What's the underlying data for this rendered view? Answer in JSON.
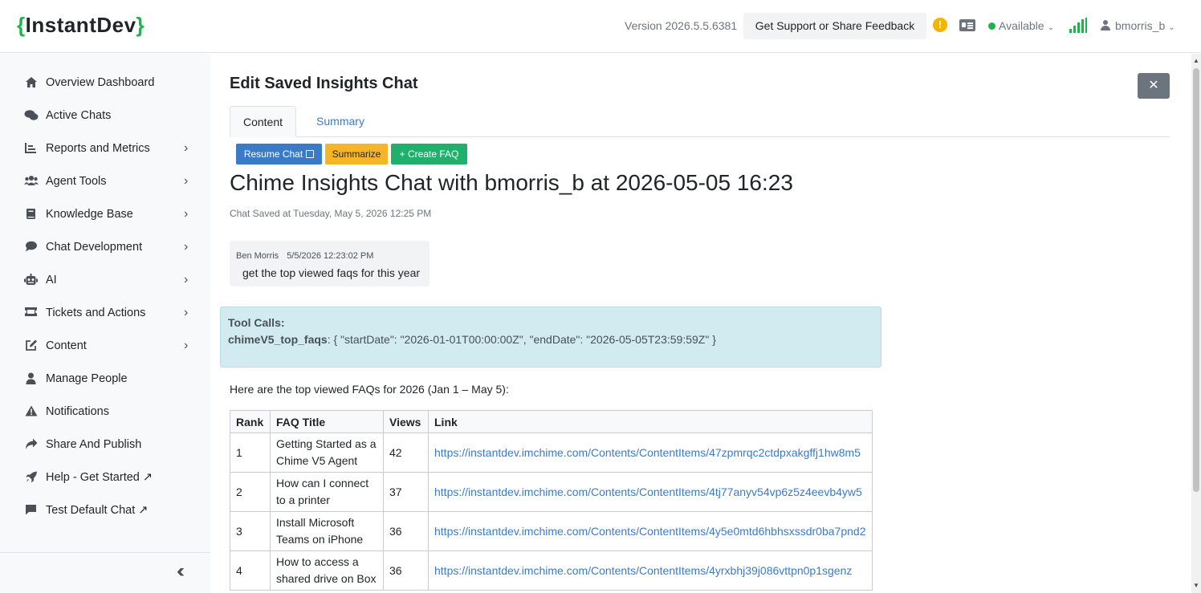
{
  "header": {
    "brand_open": "{",
    "brand_name": "InstantDev",
    "brand_close": "}",
    "version": "Version 2026.5.5.6381",
    "support_button": "Get Support or Share Feedback",
    "alert_symbol": "!",
    "status": "Available",
    "username": "bmorris_b",
    "accent_color": "#1bb54a"
  },
  "sidebar": {
    "items": [
      {
        "label": "Overview Dashboard",
        "icon": "home-icon",
        "has_submenu": false
      },
      {
        "label": "Active Chats",
        "icon": "chats-icon",
        "has_submenu": false
      },
      {
        "label": "Reports and Metrics",
        "icon": "chart-icon",
        "has_submenu": true
      },
      {
        "label": "Agent Tools",
        "icon": "users-icon",
        "has_submenu": true
      },
      {
        "label": "Knowledge Base",
        "icon": "book-icon",
        "has_submenu": true
      },
      {
        "label": "Chat Development",
        "icon": "comment-icon",
        "has_submenu": true
      },
      {
        "label": "AI",
        "icon": "robot-icon",
        "has_submenu": true
      },
      {
        "label": "Tickets and Actions",
        "icon": "ticket-icon",
        "has_submenu": true
      },
      {
        "label": "Content",
        "icon": "edit-icon",
        "has_submenu": true
      },
      {
        "label": "Manage People",
        "icon": "person-icon",
        "has_submenu": false
      },
      {
        "label": "Notifications",
        "icon": "warning-icon",
        "has_submenu": false
      },
      {
        "label": "Share And Publish",
        "icon": "share-icon",
        "has_submenu": false
      },
      {
        "label": "Help - Get Started ↗",
        "icon": "rocket-icon",
        "has_submenu": false
      },
      {
        "label": "Test Default Chat ↗",
        "icon": "message-icon",
        "has_submenu": false
      }
    ]
  },
  "main": {
    "title": "Edit Saved Insights Chat",
    "close_label": "✕",
    "tabs": [
      {
        "label": "Content",
        "active": true
      },
      {
        "label": "Summary",
        "active": false
      }
    ],
    "actions": {
      "resume": "Resume Chat",
      "summarize": "Summarize",
      "create_faq": "+ Create FAQ"
    },
    "chat_heading": "Chime Insights Chat with bmorris_b at 2026-05-05 16:23",
    "saved_at": "Chat Saved at Tuesday, May 5, 2026 12:25 PM",
    "message": {
      "author": "Ben Morris",
      "timestamp": "5/5/2026 12:23:02 PM",
      "text": "get the top viewed faqs for this year"
    },
    "tool_calls": {
      "title": "Tool Calls:",
      "function": "chimeV5_top_faqs",
      "args": ": { \"startDate\": \"2026-01-01T00:00:00Z\", \"endDate\": \"2026-05-05T23:59:59Z\" }"
    },
    "intro": "Here are the top viewed FAQs for 2026 (Jan 1 – May 5):",
    "table": {
      "headers": [
        "Rank",
        "FAQ Title",
        "Views",
        "Link"
      ],
      "rows": [
        {
          "rank": "1",
          "title": "Getting Started as a Chime V5 Agent",
          "views": "42",
          "link": "https://instantdev.imchime.com/Contents/ContentItems/47zpmrqc2ctdpxakgffj1hw8m5"
        },
        {
          "rank": "2",
          "title": "How can I connect to a printer",
          "views": "37",
          "link": "https://instantdev.imchime.com/Contents/ContentItems/4tj77anyv54vp6z5z4eevb4yw5"
        },
        {
          "rank": "3",
          "title": "Install Microsoft Teams on iPhone",
          "views": "36",
          "link": "https://instantdev.imchime.com/Contents/ContentItems/4y5e0mtd6hbhsxssdr0ba7pnd2"
        },
        {
          "rank": "4",
          "title": "How to access a shared drive on Box",
          "views": "36",
          "link": "https://instantdev.imchime.com/Contents/ContentItems/4yrxbhj39j086vttpn0p1sgenz"
        }
      ]
    }
  }
}
